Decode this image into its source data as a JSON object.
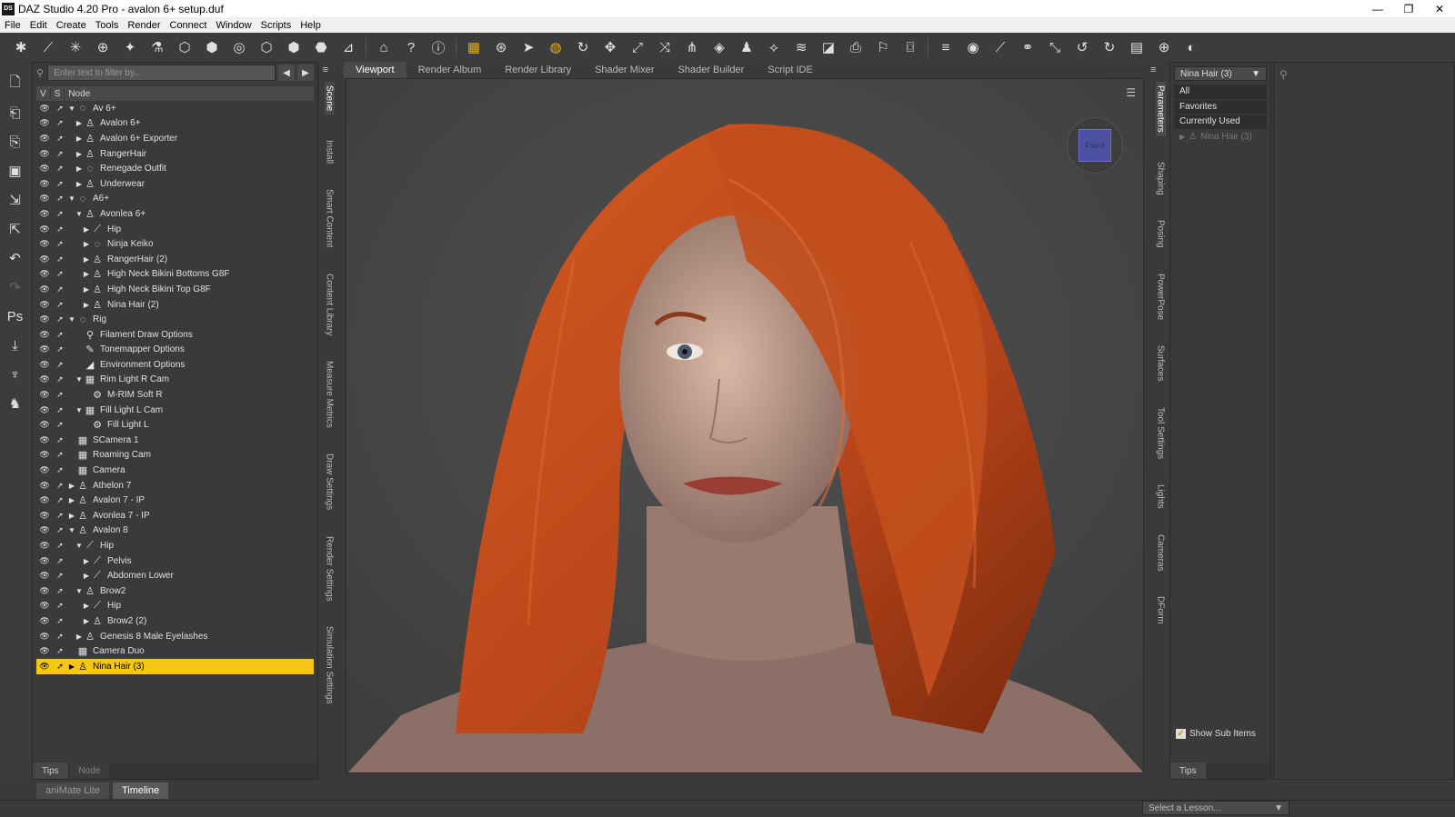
{
  "window": {
    "title": "DAZ Studio 4.20 Pro - avalon 6+ setup.duf",
    "app_icon": "DS"
  },
  "menu": [
    "File",
    "Edit",
    "Create",
    "Tools",
    "Render",
    "Connect",
    "Window",
    "Scripts",
    "Help"
  ],
  "scene": {
    "filter_placeholder": "Enter text to filter by...",
    "columns": {
      "v": "V",
      "s": "S",
      "node": "Node"
    },
    "nodes": [
      {
        "label": "Av 6+",
        "depth": 0,
        "arrow": "▼",
        "icon": "◌"
      },
      {
        "label": "Avalon 6+",
        "depth": 1,
        "arrow": "▶",
        "icon": "♙"
      },
      {
        "label": "Avalon 6+ Exporter",
        "depth": 1,
        "arrow": "▶",
        "icon": "♙"
      },
      {
        "label": "RangerHair",
        "depth": 1,
        "arrow": "▶",
        "icon": "♙"
      },
      {
        "label": "Renegade Outfit",
        "depth": 1,
        "arrow": "▶",
        "icon": "◌"
      },
      {
        "label": "Underwear",
        "depth": 1,
        "arrow": "▶",
        "icon": "♙"
      },
      {
        "label": "A6+",
        "depth": 0,
        "arrow": "▼",
        "icon": "◌"
      },
      {
        "label": "Avonlea 6+",
        "depth": 1,
        "arrow": "▼",
        "icon": "♙"
      },
      {
        "label": "Hip",
        "depth": 2,
        "arrow": "▶",
        "icon": "⟋"
      },
      {
        "label": "Ninja Keiko",
        "depth": 2,
        "arrow": "▶",
        "icon": "◌"
      },
      {
        "label": "RangerHair (2)",
        "depth": 2,
        "arrow": "▶",
        "icon": "♙"
      },
      {
        "label": "High Neck Bikini Bottoms G8F",
        "depth": 2,
        "arrow": "▶",
        "icon": "♙"
      },
      {
        "label": "High Neck Bikini Top G8F",
        "depth": 2,
        "arrow": "▶",
        "icon": "♙"
      },
      {
        "label": "Nina Hair (2)",
        "depth": 2,
        "arrow": "▶",
        "icon": "♙"
      },
      {
        "label": "Rig",
        "depth": 0,
        "arrow": "▼",
        "icon": "◌"
      },
      {
        "label": "Filament Draw Options",
        "depth": 1,
        "arrow": "",
        "icon": "⚲"
      },
      {
        "label": "Tonemapper Options",
        "depth": 1,
        "arrow": "",
        "icon": "✎"
      },
      {
        "label": "Environment Options",
        "depth": 1,
        "arrow": "",
        "icon": "◢"
      },
      {
        "label": "Rim Light R Cam",
        "depth": 1,
        "arrow": "▼",
        "icon": "▦"
      },
      {
        "label": "M-RIM Soft R",
        "depth": 2,
        "arrow": "",
        "icon": "⚙"
      },
      {
        "label": "Fill Light L Cam",
        "depth": 1,
        "arrow": "▼",
        "icon": "▦"
      },
      {
        "label": "Fill Light L",
        "depth": 2,
        "arrow": "",
        "icon": "⚙"
      },
      {
        "label": "SCamera 1",
        "depth": 0,
        "arrow": "",
        "icon": "▦"
      },
      {
        "label": "Roaming Cam",
        "depth": 0,
        "arrow": "",
        "icon": "▦"
      },
      {
        "label": "Camera",
        "depth": 0,
        "arrow": "",
        "icon": "▦"
      },
      {
        "label": "Athelon 7",
        "depth": 0,
        "arrow": "▶",
        "icon": "♙"
      },
      {
        "label": "Avalon 7 - IP",
        "depth": 0,
        "arrow": "▶",
        "icon": "♙"
      },
      {
        "label": "Avonlea 7 - IP",
        "depth": 0,
        "arrow": "▶",
        "icon": "♙"
      },
      {
        "label": "Avalon 8",
        "depth": 0,
        "arrow": "▼",
        "icon": "♙"
      },
      {
        "label": "Hip",
        "depth": 1,
        "arrow": "▼",
        "icon": "⟋"
      },
      {
        "label": "Pelvis",
        "depth": 2,
        "arrow": "▶",
        "icon": "⟋"
      },
      {
        "label": "Abdomen Lower",
        "depth": 2,
        "arrow": "▶",
        "icon": "⟋"
      },
      {
        "label": "Brow2",
        "depth": 1,
        "arrow": "▼",
        "icon": "♙"
      },
      {
        "label": "Hip",
        "depth": 2,
        "arrow": "▶",
        "icon": "⟋"
      },
      {
        "label": "Brow2 (2)",
        "depth": 2,
        "arrow": "▶",
        "icon": "♙"
      },
      {
        "label": "Genesis 8 Male Eyelashes",
        "depth": 1,
        "arrow": "▶",
        "icon": "♙"
      },
      {
        "label": "Camera Duo",
        "depth": 0,
        "arrow": "",
        "icon": "▦"
      },
      {
        "label": "Nina Hair (3)",
        "depth": 0,
        "arrow": "▶",
        "icon": "♙",
        "selected": true
      }
    ],
    "bottom_tabs": [
      "Tips",
      "Node"
    ]
  },
  "left_vtabs": [
    "Scene",
    "Install",
    "Smart Content",
    "Content Library",
    "Measure Metrics",
    "Draw Settings",
    "Render Settings",
    "Simulation Settings"
  ],
  "view_tabs": [
    "Viewport",
    "Render Album",
    "Render Library",
    "Shader Mixer",
    "Shader Builder",
    "Script IDE"
  ],
  "viewport": {
    "cube_label": "Front"
  },
  "right_vtabs": [
    "Parameters",
    "Shaping",
    "Posing",
    "PowerPose",
    "Surfaces",
    "Tool Settings",
    "Lights",
    "Cameras",
    "DForm"
  ],
  "parameters": {
    "selected_node": "Nina Hair (3)",
    "filters": [
      "All",
      "Favorites",
      "Currently Used"
    ],
    "tree_item": "Nina Hair (3)",
    "show_sub_items": "Show Sub Items",
    "bottom_tab": "Tips"
  },
  "bottom": {
    "tabs": [
      "aniMate Lite",
      "Timeline"
    ],
    "lesson_placeholder": "Select a Lesson..."
  },
  "colors": {
    "selection": "#f5c518",
    "cube": "#4d4fa0",
    "hair": "#c4501c"
  }
}
